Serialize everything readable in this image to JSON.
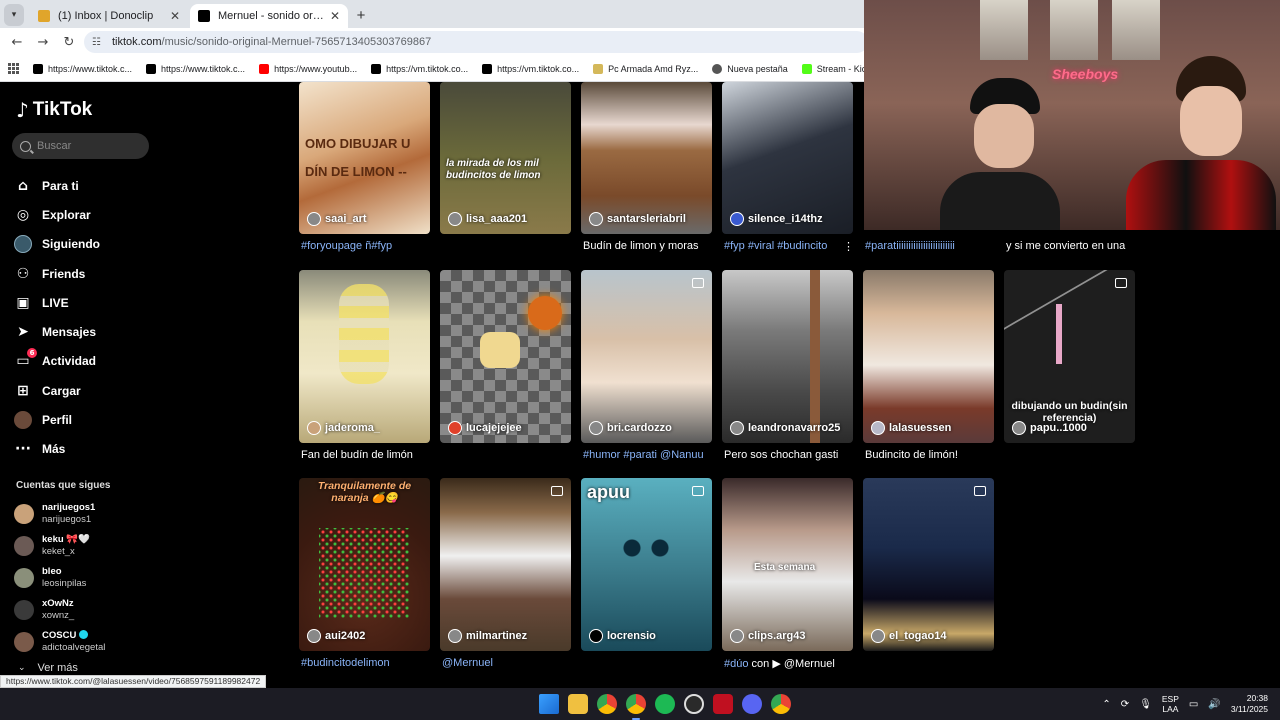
{
  "browser": {
    "tabs": [
      {
        "title": "(1) Inbox | Donoclip",
        "icon": "donoclip-icon",
        "color": "#e0a52b",
        "active": false
      },
      {
        "title": "Mernuel - sonido original - Mer",
        "icon": "tiktok-icon",
        "color": "#000000",
        "active": true
      }
    ],
    "url_host": "tiktok.com",
    "url_path": "/music/sonido-original-Mernuel-7565713405303769867",
    "bookmarks": [
      {
        "label": "https://www.tiktok.c...",
        "icon": "tiktok-icon",
        "color": "#000000"
      },
      {
        "label": "https://www.tiktok.c...",
        "icon": "tiktok-icon",
        "color": "#000000"
      },
      {
        "label": "https://www.youtub...",
        "icon": "youtube-icon",
        "color": "#ff0000"
      },
      {
        "label": "https://vm.tiktok.co...",
        "icon": "tiktok-icon",
        "color": "#000000"
      },
      {
        "label": "https://vm.tiktok.co...",
        "icon": "tiktok-icon",
        "color": "#000000"
      },
      {
        "label": "Pc Armada Amd Ryz...",
        "icon": "tag-icon",
        "color": "#d4b85a"
      },
      {
        "label": "Nueva pestaña",
        "icon": "globe-icon",
        "color": "#555555"
      },
      {
        "label": "Stream - Kick Dashb...",
        "icon": "kick-icon",
        "color": "#53fc18"
      }
    ]
  },
  "sidebar": {
    "brand": "TikTok",
    "search_placeholder": "Buscar",
    "nav": [
      {
        "label": "Para ti",
        "icon": "home-icon"
      },
      {
        "label": "Explorar",
        "icon": "compass-icon"
      },
      {
        "label": "Siguiendo",
        "icon": "following-icon"
      },
      {
        "label": "Friends",
        "icon": "friends-icon"
      },
      {
        "label": "LIVE",
        "icon": "live-icon"
      },
      {
        "label": "Mensajes",
        "icon": "messages-icon"
      },
      {
        "label": "Actividad",
        "icon": "activity-icon",
        "badge": "6"
      },
      {
        "label": "Cargar",
        "icon": "upload-icon"
      },
      {
        "label": "Perfil",
        "icon": "profile-icon"
      },
      {
        "label": "Más",
        "icon": "more-icon"
      }
    ],
    "following_title": "Cuentas que sigues",
    "following": [
      {
        "name": "narijuegos1",
        "user": "narijuegos1",
        "color": "#c9a27a"
      },
      {
        "name": "keku 🎀🤍",
        "user": "keket_x",
        "color": "#6b5a55"
      },
      {
        "name": "bleo",
        "user": "leosinpilas",
        "color": "#8a8f7a"
      },
      {
        "name": "xOwNz",
        "user": "xownz_",
        "color": "#3a3a3a"
      },
      {
        "name": "COSCU",
        "user": "adictoalvegetal",
        "color": "#7a5a4a",
        "verified": true
      }
    ],
    "more_label": "Ver más",
    "status_url": "https://www.tiktok.com/@lalasuessen/video/7568597591189982472"
  },
  "videos": [
    {
      "user": "saai_art",
      "caption": "#foryoupage ñ#fyp",
      "caption_is_tag": true,
      "overlay": "",
      "bg": "#d9a87a"
    },
    {
      "user": "lisa_aaa201",
      "caption": "",
      "caption_is_tag": false,
      "overlay": "la mirada de los mil budincitos de limon",
      "bg": "#6b6a3a"
    },
    {
      "user": "santarsleriabril",
      "caption": "Budín de limon y moras",
      "caption_is_tag": false,
      "overlay": "",
      "bg": "#9a6a42"
    },
    {
      "user": "silence_i14thz",
      "caption": "#fyp #viral #budincito",
      "caption_is_tag": true,
      "overlay": "",
      "bg": "#2e3440"
    },
    {
      "user": "",
      "caption": "#paratiiiiiiiiiiiiiiiiiiiiiiii",
      "caption_is_tag": true,
      "overlay": "",
      "bg": "#000000"
    },
    {
      "user": "",
      "caption": "y si me convierto en una",
      "caption_is_tag": false,
      "overlay": "",
      "bg": "#000000"
    },
    {
      "user": "jaderoma_",
      "caption": "Fan del budín de limón",
      "caption_is_tag": false,
      "overlay": "",
      "bg": "#c9b98a"
    },
    {
      "user": "lucajejejee",
      "caption": "",
      "caption_is_tag": false,
      "overlay": "",
      "bg": "#6d6d6d"
    },
    {
      "user": "bri.cardozzo",
      "caption": "#humor #parati @Nanuu",
      "caption_is_tag": true,
      "overlay": "",
      "bg": "#9aa8b2"
    },
    {
      "user": "leandronavarro25",
      "caption": "Pero sos chochan gasti",
      "caption_is_tag": false,
      "overlay": "",
      "bg": "#5a5a5a"
    },
    {
      "user": "lalasuessen",
      "caption": "Budincito de limón!",
      "caption_is_tag": false,
      "overlay": "",
      "bg": "#c89a8a"
    },
    {
      "user": "papu..1000",
      "caption": "",
      "caption_is_tag": false,
      "overlay": "dibujando un budin(sin referencia)",
      "bg": "#1e1e1e"
    },
    {
      "user": "aui2402",
      "caption": "#budincitodelimon",
      "caption_is_tag": true,
      "overlay": "Tranquilamente de naranja 🍊😋",
      "bg": "#5a2a1a"
    },
    {
      "user": "milmartinez",
      "caption": "@Mernuel",
      "caption_is_tag": true,
      "overlay": "",
      "bg": "#6a4a3a"
    },
    {
      "user": "locrensio",
      "caption": "",
      "caption_is_tag": false,
      "overlay": "apuu",
      "bg": "#3a7a8a"
    },
    {
      "user": "clips.arg43",
      "caption_prefix": "#dúo",
      "caption_mid": " con ",
      "caption_suffix": "▶ @Mernuel",
      "caption": "",
      "caption_is_tag": false,
      "overlay": "Esta semana",
      "bg": "#7a6a5a"
    },
    {
      "user": "el_togao14",
      "caption": "",
      "caption_is_tag": false,
      "overlay": "",
      "bg": "#1a2a4a"
    }
  ],
  "taskbar": {
    "icons": [
      "windows-icon",
      "file-explorer-icon",
      "chrome-icon",
      "chrome-profile-icon",
      "spotify-icon",
      "obs-icon",
      "app-red-icon",
      "discord-icon",
      "chrome-alt-icon"
    ],
    "lang_top": "ESP",
    "lang_bottom": "LAA",
    "time": "20:38",
    "date": "3/11/2025"
  },
  "colors": {
    "accent": "#fe2c55",
    "tag": "#8ab4f8"
  }
}
